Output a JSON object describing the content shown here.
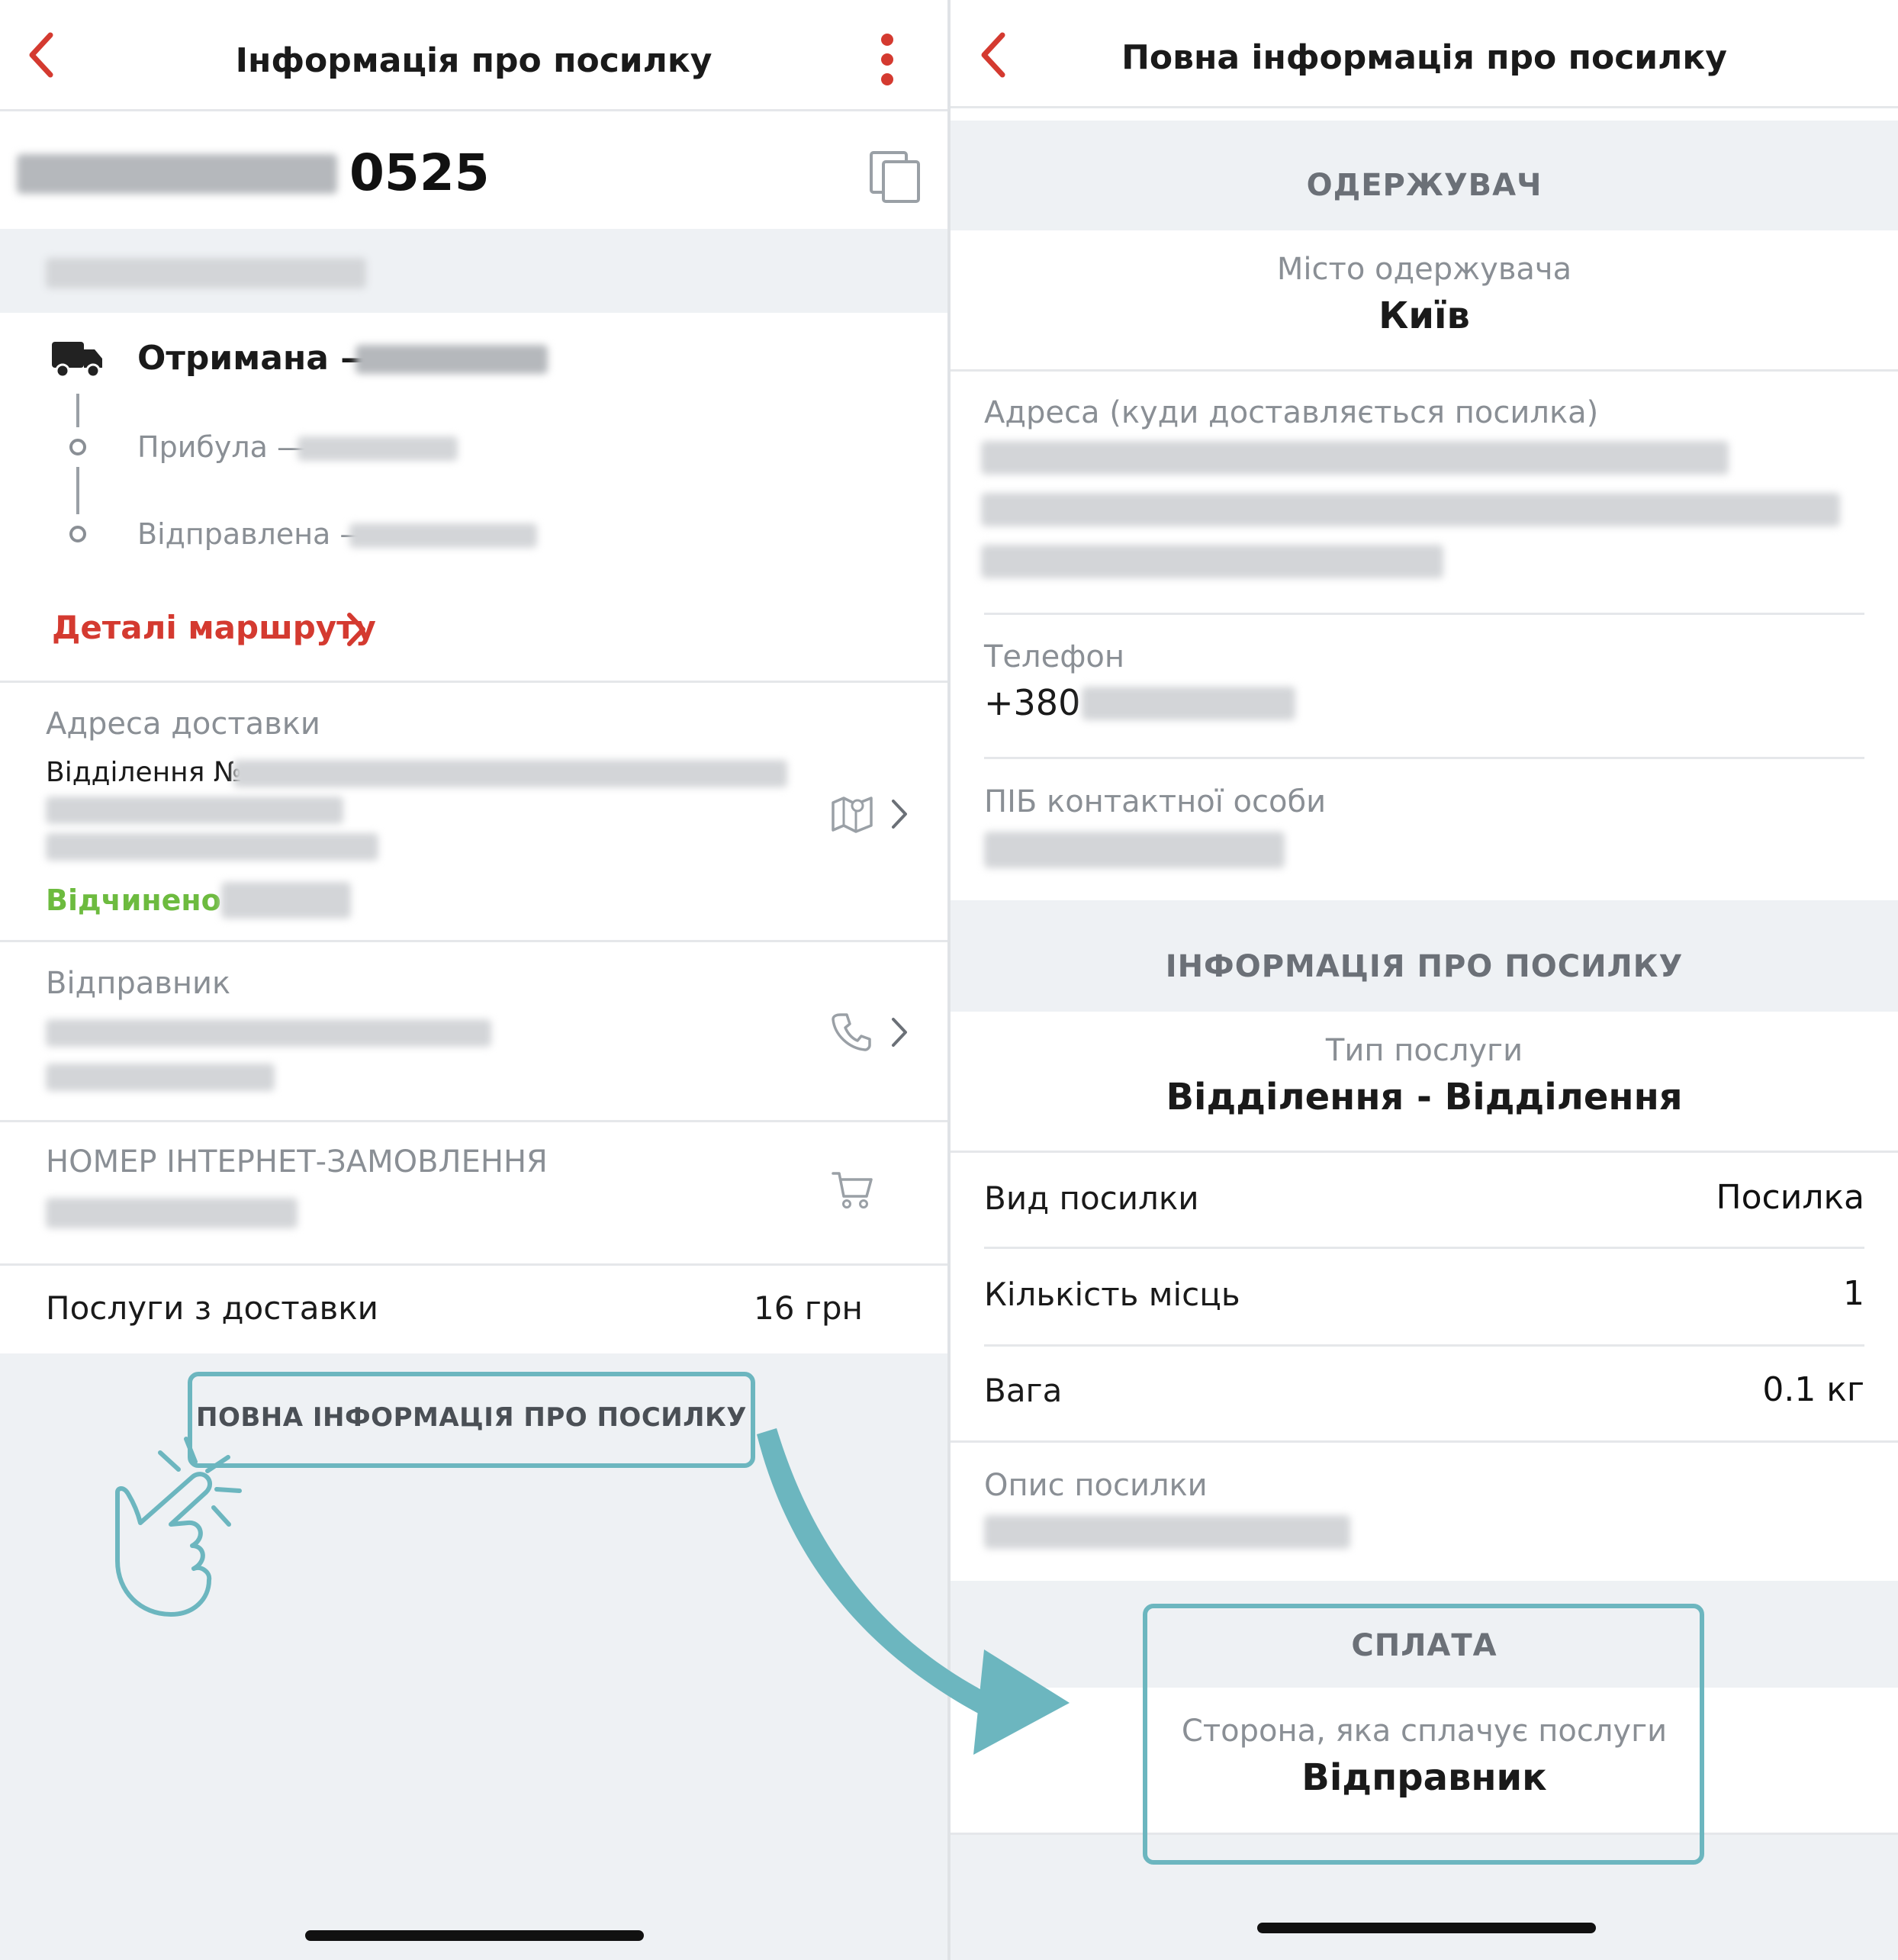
{
  "left": {
    "header": {
      "title": "Інформація про посилку",
      "back_icon": "chevron-left-icon",
      "menu_icon": "more-vertical-icon"
    },
    "tracking": {
      "number_suffix": "0525",
      "copy_icon": "copy-icon"
    },
    "status": {
      "current": "Отримана —",
      "arrived": "Прибула —",
      "sent": "Відправлена —",
      "route_link": "Деталі маршруту"
    },
    "delivery": {
      "title": "Адреса доставки",
      "branch_prefix": "Відділення №",
      "open_status": "Відчинено"
    },
    "sender": {
      "title": "Відправник"
    },
    "order": {
      "title": "НОМЕР ІНТЕРНЕТ-ЗАМОВЛЕННЯ"
    },
    "services": {
      "label": "Послуги з доставки",
      "value": "16 грн"
    },
    "full_info_button": "ПОВНА ІНФОРМАЦІЯ ПРО ПОСИЛКУ"
  },
  "right": {
    "header": {
      "title": "Повна інформація про посилку",
      "back_icon": "chevron-left-icon"
    },
    "recipient": {
      "section": "ОДЕРЖУВАЧ",
      "city_label": "Місто одержувача",
      "city": "Київ",
      "address_label": "Адреса (куди доставляється посилка)",
      "phone_label": "Телефон",
      "phone_prefix": "+380",
      "contact_label": "ПІБ контактної особи"
    },
    "parcel": {
      "section": "ІНФОРМАЦІЯ ПРО ПОСИЛКУ",
      "service_type_label": "Тип послуги",
      "service_type": "Відділення - Відділення",
      "kind_label": "Вид посилки",
      "kind": "Посилка",
      "places_label": "Кількість місць",
      "places": "1",
      "weight_label": "Вага",
      "weight": "0.1 кг",
      "description_label": "Опис посилки"
    },
    "payment": {
      "section": "СПЛАТА",
      "payer_label": "Сторона, яка сплачує послуги",
      "payer": "Відправник"
    }
  },
  "colors": {
    "brand_red": "#d43a30",
    "open_green": "#6dbb3f",
    "highlight_teal": "#6cb6bf",
    "section_bg": "#eef1f4"
  }
}
